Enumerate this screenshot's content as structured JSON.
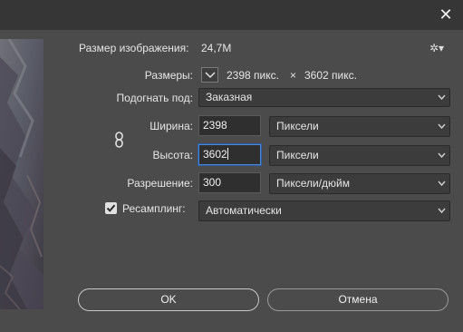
{
  "window": {
    "close_glyph": "✕"
  },
  "image_size": {
    "label": "Размер изображения:",
    "value": "24,7M"
  },
  "gear": {
    "glyph": "✲▾"
  },
  "dimensions": {
    "label": "Размеры:",
    "width": "2398 пикс.",
    "sep": "×",
    "height": "3602 пикс."
  },
  "fit_to": {
    "label": "Подогнать под:",
    "value": "Заказная"
  },
  "width": {
    "label": "Ширина:",
    "value": "2398",
    "unit": "Пиксели"
  },
  "height": {
    "label": "Высота:",
    "value": "3602",
    "unit": "Пиксели"
  },
  "resolution": {
    "label": "Разрешение:",
    "value": "300",
    "unit": "Пиксели/дюйм"
  },
  "resample": {
    "label": "Ресамплинг:",
    "checked": true,
    "value": "Автоматически"
  },
  "buttons": {
    "ok": "OK",
    "cancel": "Отмена"
  },
  "colors": {
    "bg": "#4b4b4b",
    "titlebar": "#363636",
    "focus": "#4a87d6"
  }
}
